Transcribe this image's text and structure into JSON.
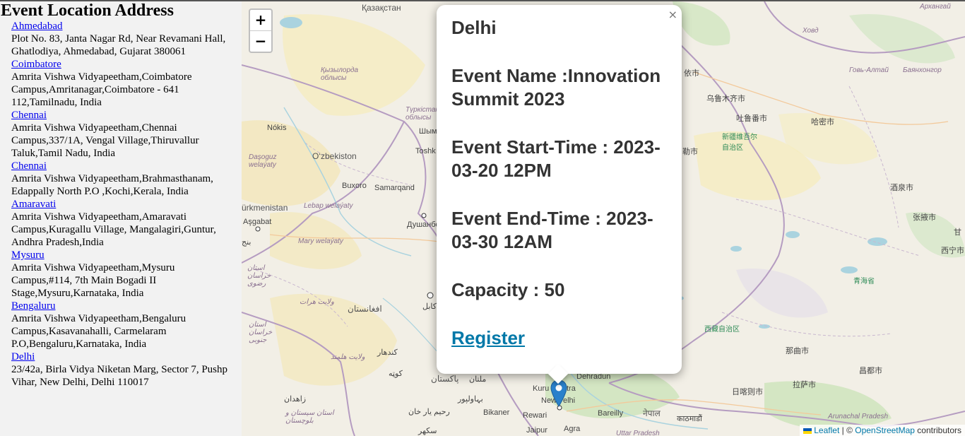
{
  "sidebar": {
    "title": "Event Location Address",
    "locations": [
      {
        "city": "Ahmedabad",
        "address": "Plot No. 83, Janta Nagar Rd, Near Revamani Hall, Ghatlodiya, Ahmedabad, Gujarat 380061"
      },
      {
        "city": "Coimbatore",
        "address": "Amrita Vishwa Vidyapeetham,Coimbatore Campus,Amritanagar,Coimbatore - 641 112,Tamilnadu, India"
      },
      {
        "city": "Chennai",
        "address": "Amrita Vishwa Vidyapeetham,Chennai Campus,337/1A, Vengal Village,Thiruvallur Taluk,Tamil Nadu, India"
      },
      {
        "city": "Chennai",
        "address": "Amrita Vishwa Vidyapeetham,Brahmasthanam, Edappally North P.O ,Kochi,Kerala, India"
      },
      {
        "city": "Amaravati",
        "address": "Amrita Vishwa Vidyapeetham,Amaravati Campus,Kuragallu Village, Mangalagiri,Guntur, Andhra Pradesh,India"
      },
      {
        "city": "Mysuru",
        "address": "Amrita Vishwa Vidyapeetham,Mysuru Campus,#114, 7th Main Bogadi II Stage,Mysuru,Karnataka, India"
      },
      {
        "city": "Bengaluru",
        "address": "Amrita Vishwa Vidyapeetham,Bengaluru Campus,Kasavanahalli, Carmelaram P.O,Bengaluru,Karnataka, India"
      },
      {
        "city": "Delhi",
        "address": "23/42a, Birla Vidya Niketan Marg, Sector 7, Pushp Vihar, New Delhi, Delhi 110017"
      }
    ]
  },
  "map": {
    "zoom_in_label": "+",
    "zoom_out_label": "−",
    "popup": {
      "close_label": "×",
      "city": "Delhi",
      "event_name": "Event Name :Innovation Summit 2023",
      "start_time": "Event Start-Time : 2023-03-20 12PM",
      "end_time": "Event End-Time : 2023-03-30 12AM",
      "capacity": "Capacity : 50",
      "register_label": "Register"
    },
    "attribution": {
      "leaflet": "Leaflet",
      "separator": " | © ",
      "osm": "OpenStreetMap",
      "suffix": " contributors"
    },
    "labels": [
      {
        "text": "Қазақстан",
        "style": "big"
      },
      {
        "text": "Архангай",
        "style": "region"
      },
      {
        "text": "Ховд",
        "style": "region"
      },
      {
        "text": "Говь-Алтай",
        "style": "region"
      },
      {
        "text": "Баянхонгор",
        "style": "region"
      },
      {
        "text": "Қызылорда облысы",
        "style": "region"
      },
      {
        "text": "Түркістан облысы",
        "style": "region"
      },
      {
        "text": "Шым",
        "style": "normal"
      },
      {
        "text": "Nókis",
        "style": "normal"
      },
      {
        "text": "O‘zbekiston",
        "style": "big"
      },
      {
        "text": "Toshk",
        "style": "normal"
      },
      {
        "text": "Daşoguz welaýaty",
        "style": "region"
      },
      {
        "text": "Buxoro",
        "style": "normal"
      },
      {
        "text": "Samarqand",
        "style": "normal"
      },
      {
        "text": "ürkmenistan",
        "style": "big"
      },
      {
        "text": "Lebap welaýaty",
        "style": "region"
      },
      {
        "text": "Душанбе",
        "style": "normal"
      },
      {
        "text": "Aşgabat",
        "style": "normal"
      },
      {
        "text": "Mary welaýaty",
        "style": "region"
      },
      {
        "text": "استان خراسان رضوی",
        "style": "region"
      },
      {
        "text": "ولایت هرات",
        "style": "region"
      },
      {
        "text": "افغانستان",
        "style": "big"
      },
      {
        "text": "کابل",
        "style": "normal"
      },
      {
        "text": "استان خراسان جنوبی",
        "style": "region"
      },
      {
        "text": "کندهار",
        "style": "normal"
      },
      {
        "text": "ولایت هلمند",
        "style": "region"
      },
      {
        "text": "کوټه",
        "style": "normal"
      },
      {
        "text": "پاکستان",
        "style": "big"
      },
      {
        "text": "ملتان",
        "style": "normal"
      },
      {
        "text": "بہاولپور",
        "style": "normal"
      },
      {
        "text": "زاهدان",
        "style": "normal"
      },
      {
        "text": "رحیم یار خان",
        "style": "normal"
      },
      {
        "text": "استان سیستان و بلوچستان",
        "style": "region"
      },
      {
        "text": "سکھر",
        "style": "normal"
      },
      {
        "text": "بنج",
        "style": "normal"
      },
      {
        "text": "Bikaner",
        "style": "normal"
      },
      {
        "text": "Rewari",
        "style": "normal"
      },
      {
        "text": "Jaipur",
        "style": "normal"
      },
      {
        "text": "Agra",
        "style": "normal"
      },
      {
        "text": "Kuru",
        "style": "normal"
      },
      {
        "text": "tra",
        "style": "normal"
      },
      {
        "text": "New",
        "style": "normal"
      },
      {
        "text": "elhi",
        "style": "normal"
      },
      {
        "text": "Dehradun",
        "style": "normal"
      },
      {
        "text": "Bareilly",
        "style": "normal"
      },
      {
        "text": "नेपाल",
        "style": "big"
      },
      {
        "text": "काठमाडौं",
        "style": "normal"
      },
      {
        "text": "Uttar Pradesh",
        "style": "region"
      },
      {
        "text": "Arunachal Pradesh",
        "style": "region"
      },
      {
        "text": "乌鲁木齐市",
        "style": "normal"
      },
      {
        "text": "吐鲁番市",
        "style": "normal"
      },
      {
        "text": "哈密市",
        "style": "normal"
      },
      {
        "text": "新疆维吾尔自治区",
        "style": "green"
      },
      {
        "text": "酒泉市",
        "style": "normal"
      },
      {
        "text": "张掖市",
        "style": "normal"
      },
      {
        "text": "西宁市",
        "style": "normal"
      },
      {
        "text": "青海省",
        "style": "green"
      },
      {
        "text": "西藏自治区",
        "style": "green"
      },
      {
        "text": "那曲市",
        "style": "normal"
      },
      {
        "text": "昌都市",
        "style": "normal"
      },
      {
        "text": "日喀则市",
        "style": "normal"
      },
      {
        "text": "拉萨市",
        "style": "normal"
      },
      {
        "text": "依市",
        "style": "normal"
      },
      {
        "text": "勒市",
        "style": "normal"
      },
      {
        "text": "甘",
        "style": "normal"
      }
    ]
  }
}
